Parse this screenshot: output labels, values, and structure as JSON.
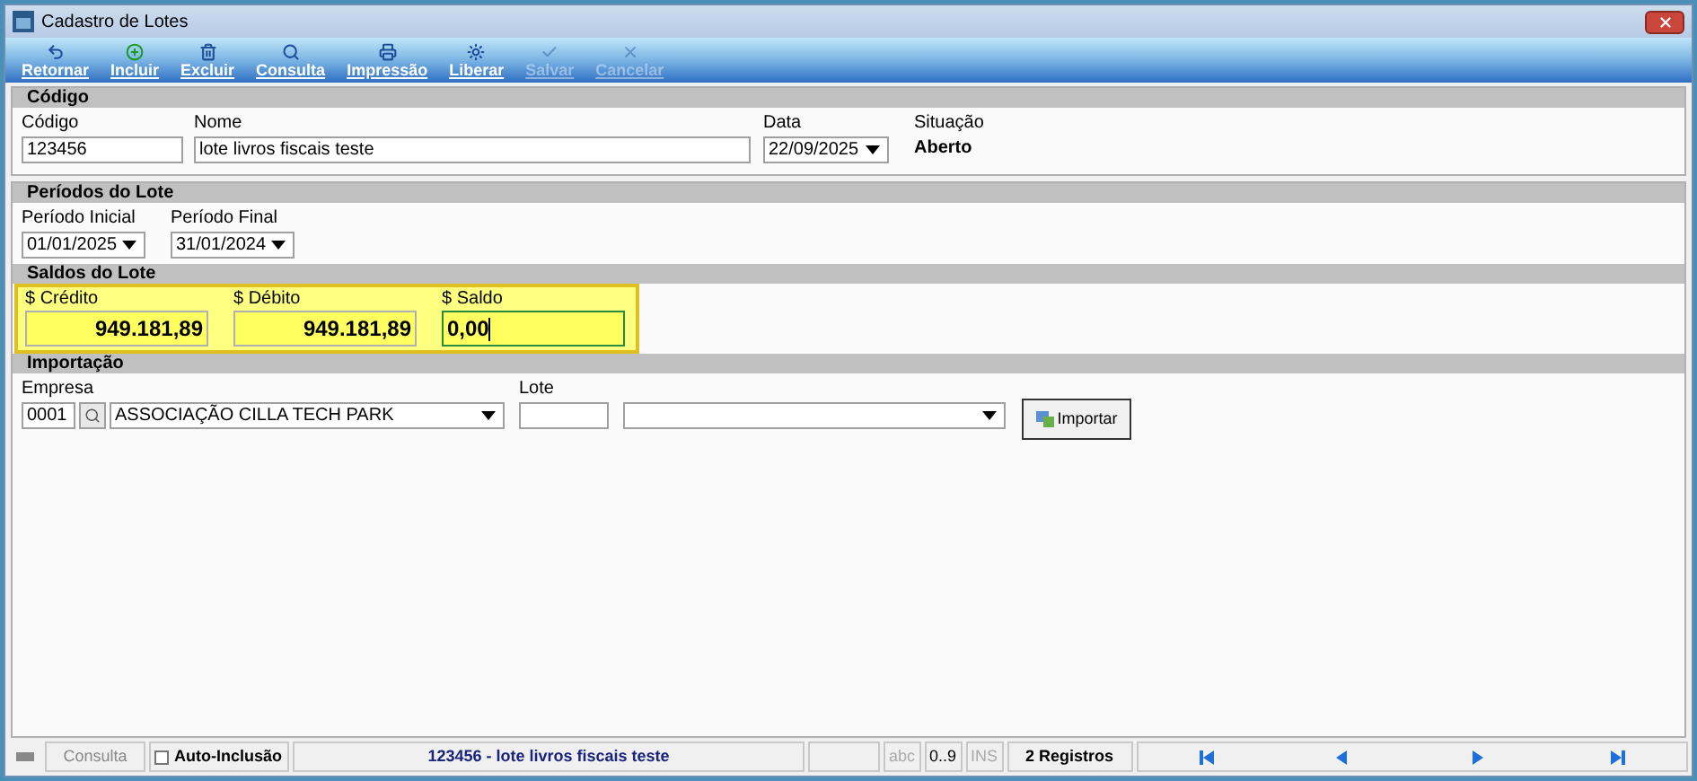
{
  "window": {
    "title": "Cadastro de Lotes"
  },
  "toolbar": [
    {
      "kind": "back",
      "label": "Retornar",
      "disabled": false
    },
    {
      "kind": "add",
      "label": "Incluir",
      "disabled": false
    },
    {
      "kind": "delete",
      "label": "Excluir",
      "disabled": false
    },
    {
      "kind": "search",
      "label": "Consulta",
      "disabled": false
    },
    {
      "kind": "print",
      "label": "Impressão",
      "disabled": false
    },
    {
      "kind": "release",
      "label": "Liberar",
      "disabled": false
    },
    {
      "kind": "save",
      "label": "Salvar",
      "disabled": true
    },
    {
      "kind": "cancel",
      "label": "Cancelar",
      "disabled": true
    }
  ],
  "codigo": {
    "header": "Código",
    "codigo_label": "Código",
    "codigo_value": "123456",
    "nome_label": "Nome",
    "nome_value": "lote livros fiscais teste",
    "data_label": "Data",
    "data_value": "22/09/2025",
    "situacao_label": "Situação",
    "situacao_value": "Aberto"
  },
  "periodos": {
    "header": "Períodos do Lote",
    "inicial_label": "Período Inicial",
    "inicial_value": "01/01/2025",
    "final_label": "Período Final",
    "final_value": "31/01/2024"
  },
  "saldos": {
    "header": "Saldos do Lote",
    "fields": [
      {
        "label": "$ Crédito",
        "value": "949.181,89",
        "focused": false
      },
      {
        "label": "$ Débito",
        "value": "949.181,89",
        "focused": false
      },
      {
        "label": "$ Saldo",
        "value": "0,00",
        "focused": true
      }
    ]
  },
  "importacao": {
    "header": "Importação",
    "empresa_label": "Empresa",
    "empresa_code": "0001",
    "empresa_name": "ASSOCIAÇÃO CILLA TECH PARK",
    "lote_label": "Lote",
    "button": "Importar"
  },
  "status_bar": {
    "mode": "Consulta",
    "auto_inclusao": {
      "label": "Auto-Inclusão",
      "checked": false
    },
    "record": "123456 - lote livros fiscais teste",
    "indicators": [
      {
        "label": "abc",
        "enabled": false
      },
      {
        "label": "0..9",
        "enabled": true
      },
      {
        "label": "INS",
        "enabled": false
      }
    ],
    "count": "2 Registros",
    "nav": [
      {
        "kind": "first"
      },
      {
        "kind": "prev"
      },
      {
        "kind": "next"
      },
      {
        "kind": "last"
      }
    ]
  }
}
